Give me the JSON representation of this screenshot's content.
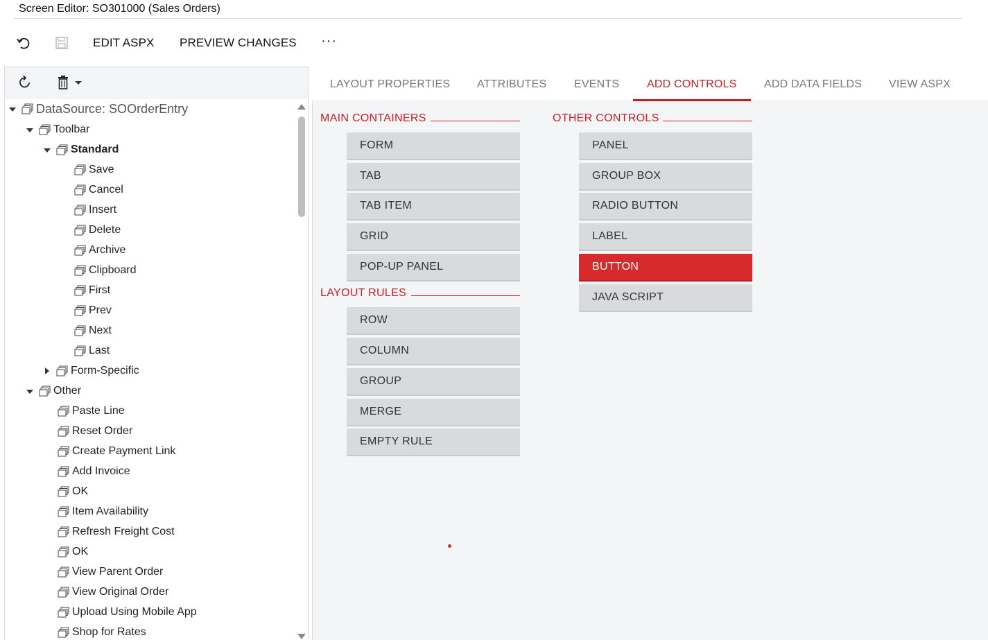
{
  "window": {
    "title": "Screen Editor: SO301000 (Sales Orders)"
  },
  "toolbar": {
    "undo_icon": "undo-icon",
    "save_icon": "save-icon",
    "edit_aspx": "EDIT ASPX",
    "preview_changes": "PREVIEW CHANGES",
    "more": "···"
  },
  "tree_toolbar": {
    "refresh_icon": "refresh-icon",
    "delete_icon": "trash-icon",
    "dropdown_icon": "chevron-down-icon"
  },
  "tree": {
    "datasource": "DataSource: SOOrderEntry",
    "toolbar": "Toolbar",
    "standard": "Standard",
    "standard_items": [
      "Save",
      "Cancel",
      "Insert",
      "Delete",
      "Archive",
      "Clipboard",
      "First",
      "Prev",
      "Next",
      "Last"
    ],
    "form_specific": "Form-Specific",
    "other": "Other",
    "other_items": [
      "Paste Line",
      "Reset Order",
      "Create Payment Link",
      "Add Invoice",
      "OK",
      "Item Availability",
      "Refresh Freight Cost",
      "OK",
      "View Parent Order",
      "View Original Order",
      "Upload Using Mobile App",
      "Shop for Rates"
    ]
  },
  "tabs": {
    "labels": [
      "LAYOUT PROPERTIES",
      "ATTRIBUTES",
      "EVENTS",
      "ADD CONTROLS",
      "ADD DATA FIELDS",
      "VIEW ASPX"
    ],
    "active": "ADD CONTROLS"
  },
  "add_controls": {
    "main_containers": {
      "title": "MAIN CONTAINERS",
      "items": [
        "FORM",
        "TAB",
        "TAB ITEM",
        "GRID",
        "POP-UP PANEL"
      ]
    },
    "layout_rules": {
      "title": "LAYOUT RULES",
      "items": [
        "ROW",
        "COLUMN",
        "GROUP",
        "MERGE",
        "EMPTY RULE"
      ]
    },
    "other_controls": {
      "title": "OTHER CONTROLS",
      "items": [
        "PANEL",
        "GROUP BOX",
        "RADIO BUTTON",
        "LABEL",
        "BUTTON",
        "JAVA SCRIPT"
      ],
      "selected": "BUTTON"
    }
  },
  "colors": {
    "accent": "#c91e24",
    "selected_control": "#d62a2c",
    "control_bg": "#d9dadc",
    "panel_bg": "#f4f5f7"
  }
}
